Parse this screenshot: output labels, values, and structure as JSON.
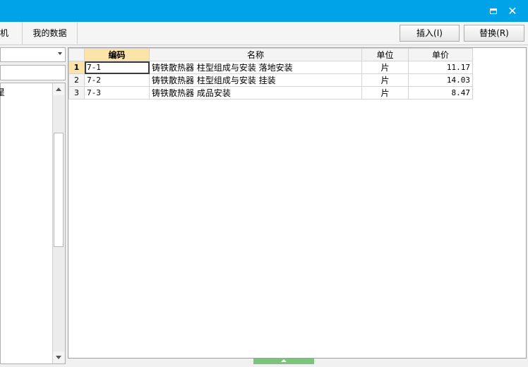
{
  "tabs": [
    {
      "label": "机"
    },
    {
      "label": "我的数据"
    }
  ],
  "buttons": {
    "insert": "插入(I)",
    "replace": "替换(R)"
  },
  "tree": {
    "partial_item": "星"
  },
  "grid": {
    "columns": [
      "编码",
      "名称",
      "单位",
      "单价"
    ],
    "rows": [
      {
        "num": "1",
        "code": "7-1",
        "name": "铸铁散热器 柱型组成与安装 落地安装",
        "unit": "片",
        "price": "11.17"
      },
      {
        "num": "2",
        "code": "7-2",
        "name": "铸铁散热器 柱型组成与安装 挂装",
        "unit": "片",
        "price": "14.03"
      },
      {
        "num": "3",
        "code": "7-3",
        "name": "铸铁散热器 成品安装",
        "unit": "片",
        "price": "8.47"
      }
    ]
  },
  "colors": {
    "titlebar": "#00a2e8",
    "selected_header": "#fce4a8",
    "handle": "#7cc47c"
  }
}
